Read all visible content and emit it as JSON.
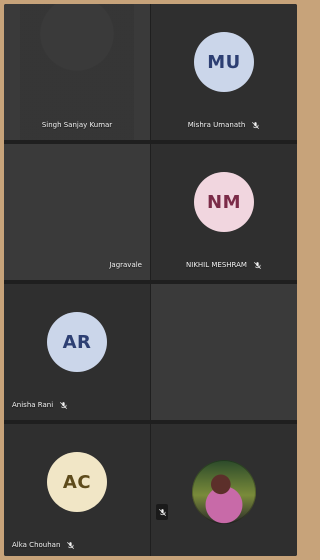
{
  "participants": [
    {
      "name": "Singh Sanjay Kumar",
      "type": "video"
    },
    {
      "name": "Mishra Umanath",
      "initials": "MU",
      "type": "avatar",
      "avatar_bg": "#cbd6ea",
      "avatar_fg": "#2d3f73",
      "muted": true
    },
    {
      "name": "",
      "suffix": "Jagravale",
      "type": "video"
    },
    {
      "name": "NIKHIL MESHRAM",
      "initials": "NM",
      "type": "avatar",
      "avatar_bg": "#f1d6df",
      "avatar_fg": "#7b2b48",
      "muted": true
    },
    {
      "name": "Anisha Rani",
      "initials": "AR",
      "type": "avatar",
      "avatar_bg": "#cbd6ea",
      "avatar_fg": "#2d3f73",
      "muted": true
    },
    {
      "name": "",
      "type": "video"
    },
    {
      "name": "Alka Chouhan",
      "initials": "AC",
      "type": "avatar",
      "avatar_bg": "#f1e6c6",
      "avatar_fg": "#5e4b1b",
      "muted": true
    },
    {
      "name": "",
      "type": "photo"
    }
  ],
  "icons": {
    "mic_off": "mic-off-icon"
  }
}
